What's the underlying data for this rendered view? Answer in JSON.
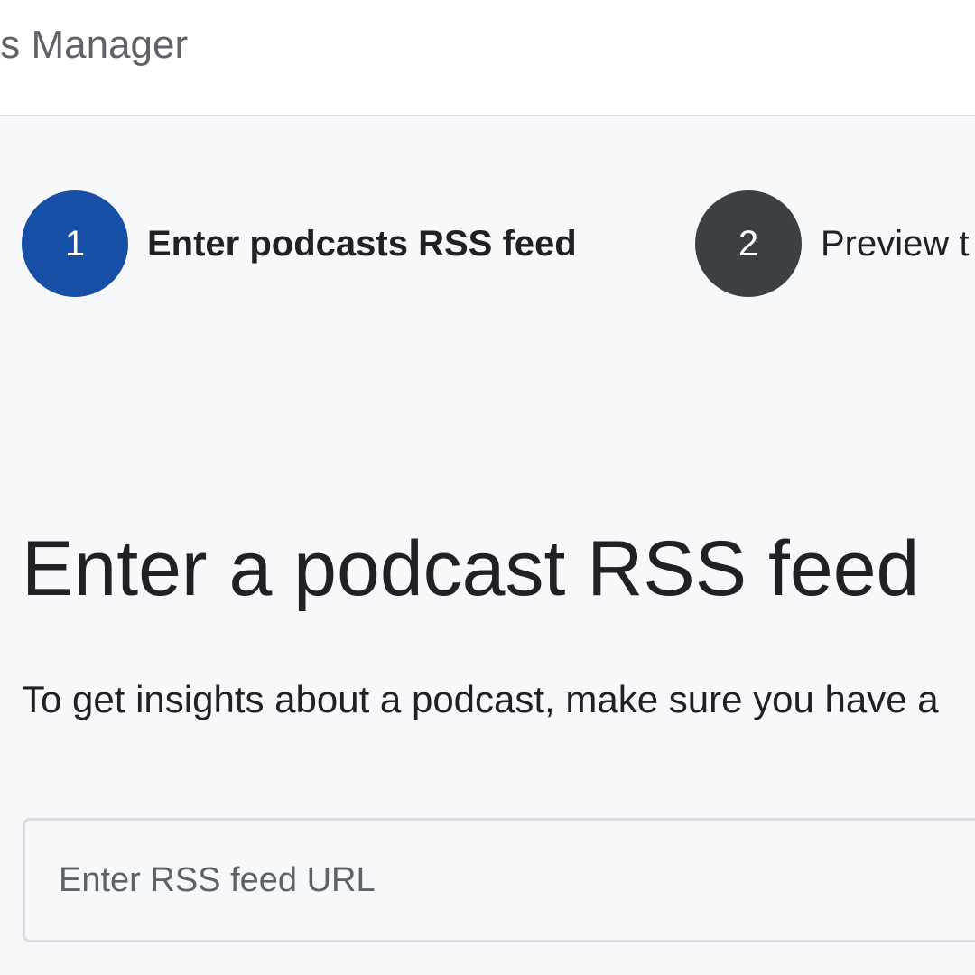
{
  "header": {
    "app_title": "ts Manager"
  },
  "stepper": {
    "steps": [
      {
        "number": "1",
        "label": "Enter podcasts RSS feed",
        "state": "active",
        "color": "#174ea6"
      },
      {
        "number": "2",
        "label": "Preview t",
        "state": "inactive",
        "color": "#3c4043"
      }
    ]
  },
  "main": {
    "heading": "Enter a podcast RSS feed",
    "description": "To get insights about a podcast, make sure you have a",
    "rss_input": {
      "value": "",
      "placeholder": "Enter RSS feed URL"
    }
  }
}
